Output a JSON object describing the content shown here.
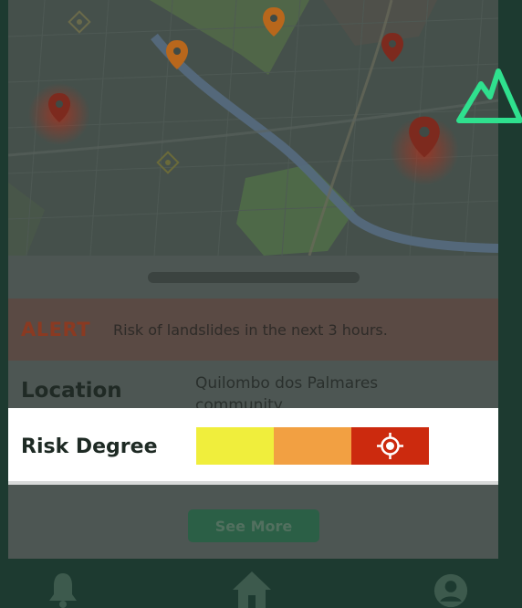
{
  "alert": {
    "tag": "ALERT",
    "message": "Risk of landslides in the next 3 hours."
  },
  "location": {
    "label": "Location",
    "value": "Quilombo dos Palmares community"
  },
  "risk": {
    "label": "Risk Degree",
    "levels": [
      {
        "name": "low",
        "color": "#f0ee3c"
      },
      {
        "name": "medium",
        "color": "#f2a042"
      },
      {
        "name": "high",
        "color": "#cc2a0e"
      }
    ],
    "selected_level": "high",
    "indicator_icon": "target-icon"
  },
  "actions": {
    "see_more_label": "See More"
  },
  "nav": {
    "items": [
      "bell-icon",
      "home-icon",
      "user-icon"
    ]
  },
  "colors": {
    "accent_green": "#2fe08e",
    "pin_brown": "#7d2a1e",
    "pin_orange": "#b8671c"
  }
}
